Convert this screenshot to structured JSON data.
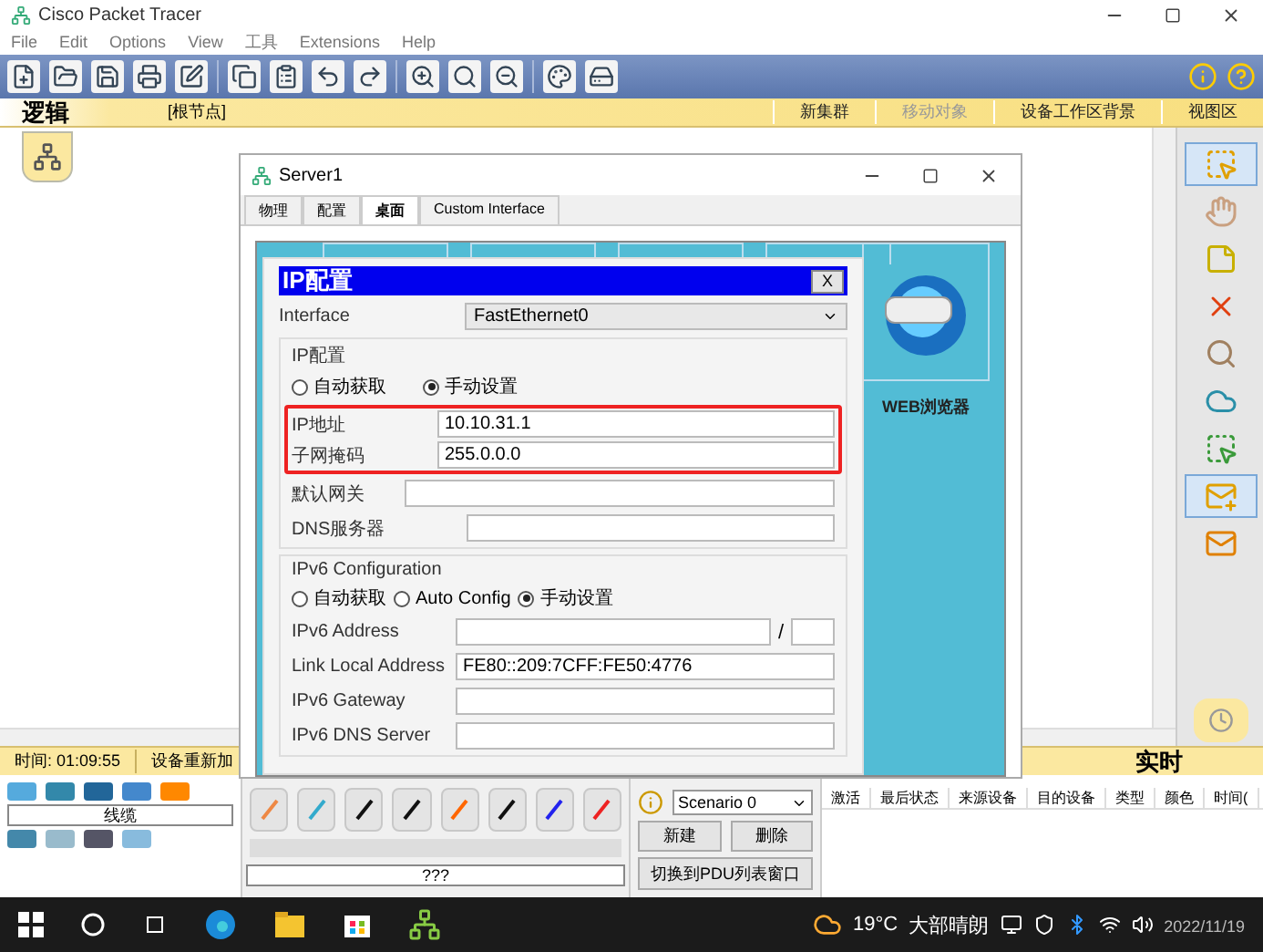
{
  "app": {
    "title": "Cisco Packet Tracer"
  },
  "menu": [
    "File",
    "Edit",
    "Options",
    "View",
    "工具",
    "Extensions",
    "Help"
  ],
  "workspace_bar": {
    "tab": "逻辑",
    "path": "[根节点]",
    "actions": [
      {
        "label": "新集群",
        "disabled": false
      },
      {
        "label": "移动对象",
        "disabled": true
      },
      {
        "label": "设备工作区背景",
        "disabled": false
      },
      {
        "label": "视图区",
        "disabled": false
      }
    ]
  },
  "tools": [
    {
      "kind": "select",
      "selected": true
    },
    {
      "kind": "hand",
      "selected": false
    },
    {
      "kind": "note",
      "selected": false
    },
    {
      "kind": "delete",
      "selected": false
    },
    {
      "kind": "inspect",
      "selected": false
    },
    {
      "kind": "shape",
      "selected": false
    },
    {
      "kind": "resize",
      "selected": false
    },
    {
      "kind": "simple-pdu",
      "selected": true
    },
    {
      "kind": "complex-pdu",
      "selected": false
    }
  ],
  "status_bar": {
    "time": "时间: 01:09:55",
    "power_cycle": "设备重新加",
    "mode": "实时"
  },
  "device_panel": {
    "category_label": "线缆",
    "connection_label": "???"
  },
  "scenario": {
    "select": "Scenario 0",
    "buttons": [
      "新建",
      "删除"
    ],
    "toggle": "切换到PDU列表窗口"
  },
  "pdu_table": {
    "columns": [
      "激活",
      "最后状态",
      "来源设备",
      "目的设备",
      "类型",
      "颜色",
      "时间("
    ]
  },
  "dialog": {
    "title": "Server1",
    "tabs": [
      {
        "label": "物理",
        "selected": false
      },
      {
        "label": "配置",
        "selected": false
      },
      {
        "label": "桌面",
        "selected": true
      },
      {
        "label": "Custom Interface",
        "selected": false
      }
    ],
    "desktop_app": "WEB浏览器",
    "ip_panel": {
      "title": "IP配置",
      "close": "X",
      "interface_label": "Interface",
      "interface_value": "FastEthernet0",
      "ipv4_group": "IP配置",
      "ipv4_modes": [
        {
          "label": "自动获取",
          "selected": false
        },
        {
          "label": "手动设置",
          "selected": true
        }
      ],
      "ipv4_highlighted": true,
      "ipv4_fields": [
        {
          "label": "IP地址",
          "value": "10.10.31.1"
        },
        {
          "label": "子网掩码",
          "value": "255.0.0.0"
        },
        {
          "label": "默认网关"
        },
        {
          "label": "DNS服务器"
        }
      ],
      "ipv6_group": "IPv6 Configuration",
      "ipv6_modes": [
        {
          "label": "自动获取",
          "selected": false
        },
        {
          "label": "Auto Config",
          "selected": false
        },
        {
          "label": "手动设置",
          "selected": true
        }
      ],
      "ipv6_address_label": "IPv6 Address",
      "ipv6_slash": "/",
      "ipv6_fields": [
        {
          "label": "Link Local Address",
          "value": "FE80::209:7CFF:FE50:4776"
        },
        {
          "label": "IPv6 Gateway"
        },
        {
          "label": "IPv6 DNS Server"
        }
      ]
    }
  },
  "taskbar": {
    "temperature": "19°C",
    "weather": "大部晴朗",
    "date": "2022/11/19"
  }
}
